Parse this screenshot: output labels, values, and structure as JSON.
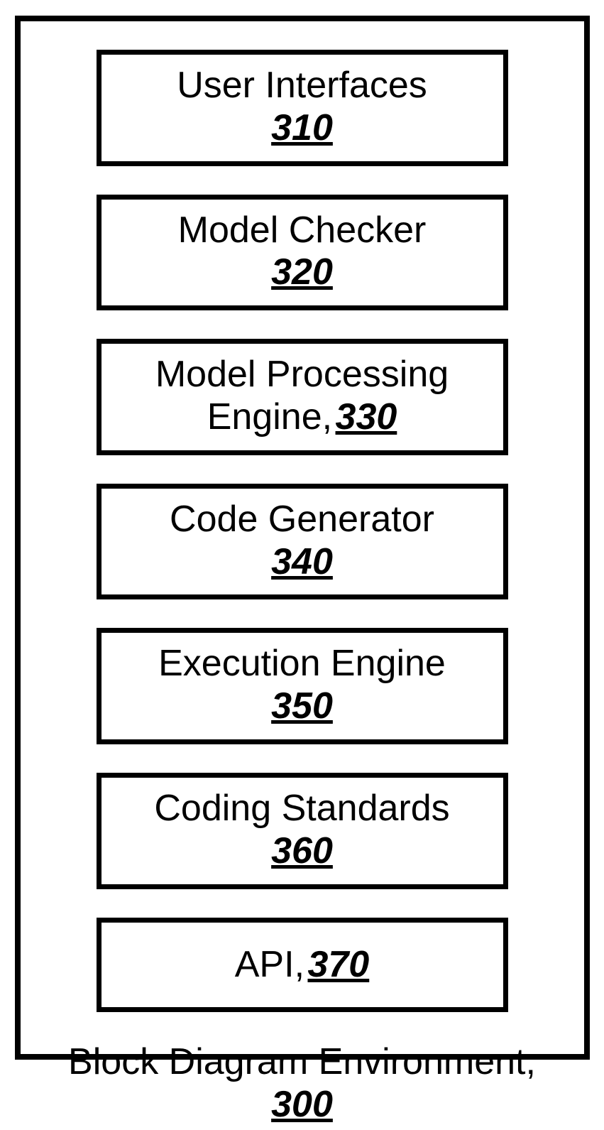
{
  "boxes": [
    {
      "label": "User Interfaces",
      "num": "310",
      "inline": false
    },
    {
      "label": "Model Checker",
      "num": "320",
      "inline": false
    },
    {
      "label": "Model Processing Engine,",
      "num": "330",
      "inline": true
    },
    {
      "label": "Code Generator",
      "num": "340",
      "inline": false
    },
    {
      "label": "Execution Engine",
      "num": "350",
      "inline": false
    },
    {
      "label": "Coding Standards",
      "num": "360",
      "inline": false
    },
    {
      "label": "API,",
      "num": "370",
      "inline": true,
      "api": true
    }
  ],
  "caption": {
    "label": "Block Diagram Environment,",
    "num": "300"
  }
}
